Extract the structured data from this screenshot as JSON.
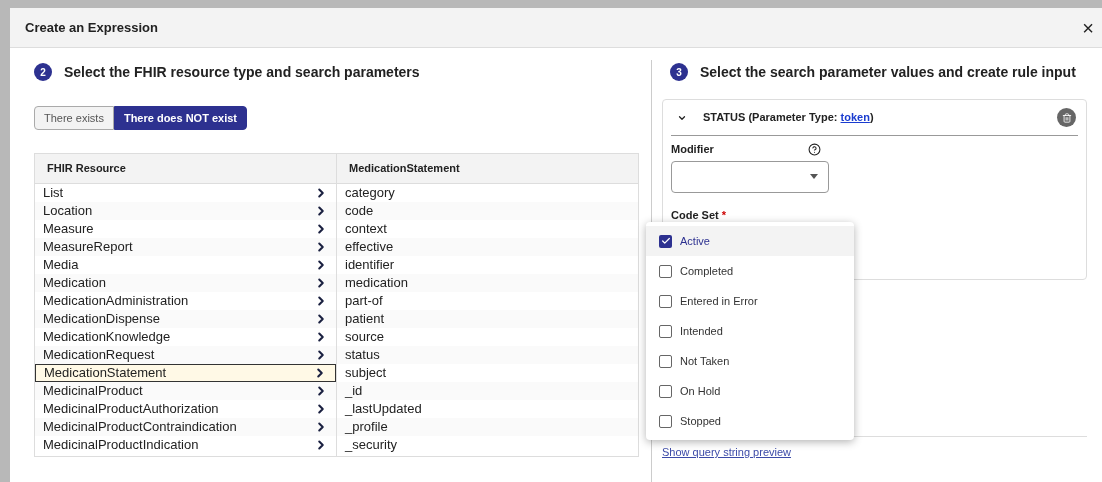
{
  "dialog": {
    "title": "Create an Expression",
    "close": "×"
  },
  "left": {
    "step": "2",
    "heading": "Select the FHIR resource type and search parameters",
    "toggle": [
      {
        "label": "There exists",
        "selected": false
      },
      {
        "label": "There does NOT exist",
        "selected": true
      }
    ],
    "columns": [
      "FHIR Resource",
      "MedicationStatement"
    ],
    "resources": [
      {
        "name": "List",
        "selected": false
      },
      {
        "name": "Location",
        "selected": false
      },
      {
        "name": "Measure",
        "selected": false
      },
      {
        "name": "MeasureReport",
        "selected": false
      },
      {
        "name": "Media",
        "selected": false
      },
      {
        "name": "Medication",
        "selected": false
      },
      {
        "name": "MedicationAdministration",
        "selected": false
      },
      {
        "name": "MedicationDispense",
        "selected": false
      },
      {
        "name": "MedicationKnowledge",
        "selected": false
      },
      {
        "name": "MedicationRequest",
        "selected": false
      },
      {
        "name": "MedicationStatement",
        "selected": true
      },
      {
        "name": "MedicinalProduct",
        "selected": false
      },
      {
        "name": "MedicinalProductAuthorization",
        "selected": false
      },
      {
        "name": "MedicinalProductContraindication",
        "selected": false
      },
      {
        "name": "MedicinalProductIndication",
        "selected": false
      }
    ],
    "parameters": [
      "category",
      "code",
      "context",
      "effective",
      "identifier",
      "medication",
      "part-of",
      "patient",
      "source",
      "status",
      "subject",
      "_id",
      "_lastUpdated",
      "_profile",
      "_security"
    ]
  },
  "right": {
    "step": "3",
    "heading": "Select the search parameter values and create rule input",
    "parameter": {
      "expanded": true,
      "title": "STATUS (Parameter Type: ",
      "type_link": "token",
      "title_end": ")",
      "modifier_label": "Modifier",
      "code_set_label": "Code Set",
      "required_mark": "*"
    },
    "options": [
      {
        "label": "Active",
        "checked": true,
        "highlighted": true
      },
      {
        "label": "Completed",
        "checked": false,
        "highlighted": false
      },
      {
        "label": "Entered in Error",
        "checked": false,
        "highlighted": false
      },
      {
        "label": "Intended",
        "checked": false,
        "highlighted": false
      },
      {
        "label": "Not Taken",
        "checked": false,
        "highlighted": false
      },
      {
        "label": "On Hold",
        "checked": false,
        "highlighted": false
      },
      {
        "label": "Stopped",
        "checked": false,
        "highlighted": false
      }
    ],
    "link": "Show query string preview"
  }
}
